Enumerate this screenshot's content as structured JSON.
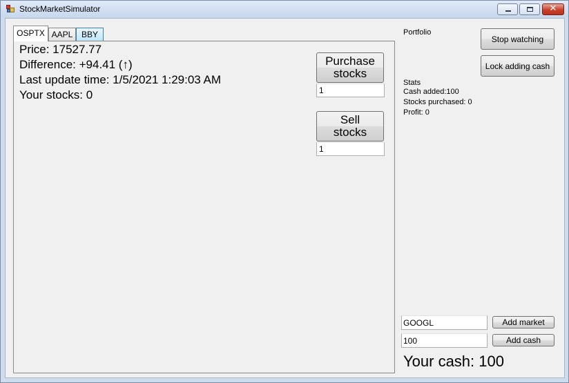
{
  "window": {
    "title": "StockMarketSimulator"
  },
  "tabs": [
    {
      "label": "OSPTX"
    },
    {
      "label": "AAPL"
    },
    {
      "label": "BBY"
    }
  ],
  "stock": {
    "price": "Price: 17527.77",
    "difference": "Difference: +94.41 (↑)",
    "last_update": "Last update time: 1/5/2021 1:29:03 AM",
    "your_stocks": "Your stocks: 0"
  },
  "purchase": {
    "label_line1": "Purchase",
    "label_line2": "stocks",
    "quantity": "1"
  },
  "sell": {
    "label_line1": "Sell",
    "label_line2": "stocks",
    "quantity": "1"
  },
  "portfolio": {
    "label": "Portfolio"
  },
  "buttons": {
    "stop_watching": "Stop watching",
    "lock_adding_cash": "Lock adding cash",
    "add_market": "Add market",
    "add_cash": "Add cash"
  },
  "stats": {
    "heading": "Stats",
    "cash_added": "Cash added:100",
    "stocks_purchased": "Stocks purchased: 0",
    "profit": "Profit: 0"
  },
  "market_input": {
    "value": "GOOGL"
  },
  "cash_input": {
    "value": "100"
  },
  "cash_display": "Your cash: 100",
  "colors": {
    "tab_hover": "#bee6fd",
    "close_button": "#c7412b",
    "titlebar": "#dfe9f7"
  },
  "icons": {
    "app": "app-icon",
    "minimize": "minimize-icon",
    "maximize": "maximize-icon",
    "close": "close-icon"
  }
}
